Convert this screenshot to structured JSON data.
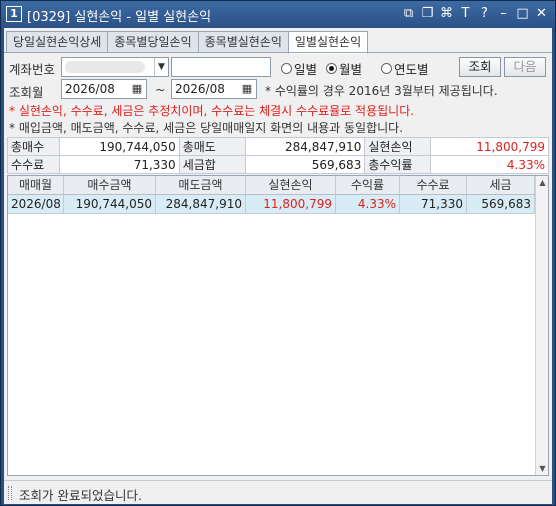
{
  "window": {
    "number": "1",
    "title": "[0329] 실현손익 - 일별 실현손익",
    "icons": [
      "layout-icon",
      "copy-icon",
      "link-icon",
      "font-icon",
      "help-icon",
      "minimize-icon",
      "maximize-icon",
      "close-icon"
    ],
    "icon_glyphs": [
      "⧉",
      "❐",
      "⌘",
      "T",
      "?",
      "–",
      "□",
      "✕"
    ]
  },
  "tabs": [
    "당일실현손익상세",
    "종목별당일손익",
    "종목별실현손익",
    "일별실현손익"
  ],
  "query": {
    "account_label": "계좌번호",
    "period_label": "조회월",
    "from": "2026/08",
    "tilde": "~",
    "to": "2026/08",
    "radios": [
      "일별",
      "월별",
      "연도별"
    ],
    "selected_radio": "월별",
    "search_button": "조회",
    "next_button": "다음",
    "notice": "* 수익률의 경우 2016년 3월부터 제공됩니다.",
    "warning": "* 실현손익, 수수료, 세금은 추정치이며, 수수료는 체결시 수수료율로 적용됩니다.",
    "info": "* 매입금액, 매도금액, 수수료, 세금은 당일매매일지 화면의 내용과 동일합니다."
  },
  "summary": {
    "total_buy_label": "총매수",
    "total_buy": "190,744,050",
    "total_sell_label": "총매도",
    "total_sell": "284,847,910",
    "realized_label": "실현손익",
    "realized": "11,800,799",
    "fee_label": "수수료",
    "fee": "71,330",
    "tax_label": "세금합",
    "tax": "569,683",
    "return_label": "총수익률",
    "return": "4.33%"
  },
  "grid": {
    "headers": [
      "매매월",
      "매수금액",
      "매도금액",
      "실현손익",
      "수익률",
      "수수료",
      "세금"
    ],
    "rows": [
      [
        "2026/08",
        "190,744,050",
        "284,847,910",
        "11,800,799",
        "4.33%",
        "71,330",
        "569,683"
      ]
    ]
  },
  "status": "조회가 완료되었습니다.",
  "colors": {
    "titlebar": "#2a5288",
    "profit": "#e0201c",
    "selected_row": "#d8ecf6"
  }
}
